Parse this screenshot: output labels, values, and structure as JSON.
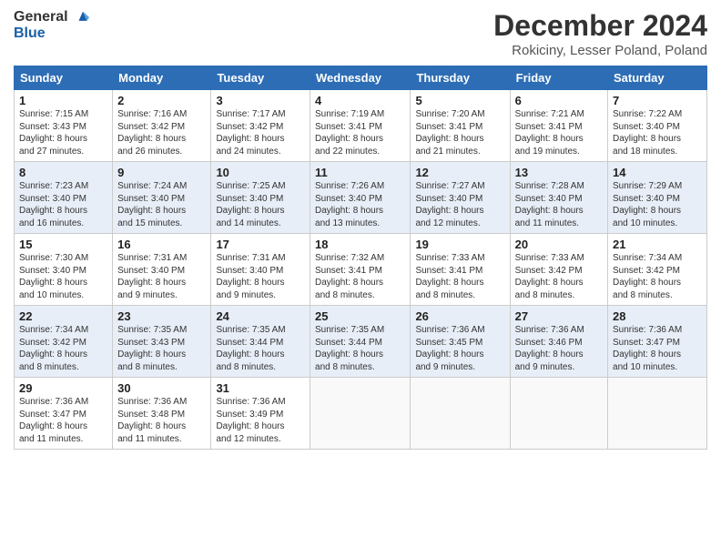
{
  "header": {
    "logo_line1": "General",
    "logo_line2": "Blue",
    "title": "December 2024",
    "subtitle": "Rokiciny, Lesser Poland, Poland"
  },
  "weekdays": [
    "Sunday",
    "Monday",
    "Tuesday",
    "Wednesday",
    "Thursday",
    "Friday",
    "Saturday"
  ],
  "weeks": [
    [
      {
        "day": "1",
        "info": "Sunrise: 7:15 AM\nSunset: 3:43 PM\nDaylight: 8 hours\nand 27 minutes."
      },
      {
        "day": "2",
        "info": "Sunrise: 7:16 AM\nSunset: 3:42 PM\nDaylight: 8 hours\nand 26 minutes."
      },
      {
        "day": "3",
        "info": "Sunrise: 7:17 AM\nSunset: 3:42 PM\nDaylight: 8 hours\nand 24 minutes."
      },
      {
        "day": "4",
        "info": "Sunrise: 7:19 AM\nSunset: 3:41 PM\nDaylight: 8 hours\nand 22 minutes."
      },
      {
        "day": "5",
        "info": "Sunrise: 7:20 AM\nSunset: 3:41 PM\nDaylight: 8 hours\nand 21 minutes."
      },
      {
        "day": "6",
        "info": "Sunrise: 7:21 AM\nSunset: 3:41 PM\nDaylight: 8 hours\nand 19 minutes."
      },
      {
        "day": "7",
        "info": "Sunrise: 7:22 AM\nSunset: 3:40 PM\nDaylight: 8 hours\nand 18 minutes."
      }
    ],
    [
      {
        "day": "8",
        "info": "Sunrise: 7:23 AM\nSunset: 3:40 PM\nDaylight: 8 hours\nand 16 minutes."
      },
      {
        "day": "9",
        "info": "Sunrise: 7:24 AM\nSunset: 3:40 PM\nDaylight: 8 hours\nand 15 minutes."
      },
      {
        "day": "10",
        "info": "Sunrise: 7:25 AM\nSunset: 3:40 PM\nDaylight: 8 hours\nand 14 minutes."
      },
      {
        "day": "11",
        "info": "Sunrise: 7:26 AM\nSunset: 3:40 PM\nDaylight: 8 hours\nand 13 minutes."
      },
      {
        "day": "12",
        "info": "Sunrise: 7:27 AM\nSunset: 3:40 PM\nDaylight: 8 hours\nand 12 minutes."
      },
      {
        "day": "13",
        "info": "Sunrise: 7:28 AM\nSunset: 3:40 PM\nDaylight: 8 hours\nand 11 minutes."
      },
      {
        "day": "14",
        "info": "Sunrise: 7:29 AM\nSunset: 3:40 PM\nDaylight: 8 hours\nand 10 minutes."
      }
    ],
    [
      {
        "day": "15",
        "info": "Sunrise: 7:30 AM\nSunset: 3:40 PM\nDaylight: 8 hours\nand 10 minutes."
      },
      {
        "day": "16",
        "info": "Sunrise: 7:31 AM\nSunset: 3:40 PM\nDaylight: 8 hours\nand 9 minutes."
      },
      {
        "day": "17",
        "info": "Sunrise: 7:31 AM\nSunset: 3:40 PM\nDaylight: 8 hours\nand 9 minutes."
      },
      {
        "day": "18",
        "info": "Sunrise: 7:32 AM\nSunset: 3:41 PM\nDaylight: 8 hours\nand 8 minutes."
      },
      {
        "day": "19",
        "info": "Sunrise: 7:33 AM\nSunset: 3:41 PM\nDaylight: 8 hours\nand 8 minutes."
      },
      {
        "day": "20",
        "info": "Sunrise: 7:33 AM\nSunset: 3:42 PM\nDaylight: 8 hours\nand 8 minutes."
      },
      {
        "day": "21",
        "info": "Sunrise: 7:34 AM\nSunset: 3:42 PM\nDaylight: 8 hours\nand 8 minutes."
      }
    ],
    [
      {
        "day": "22",
        "info": "Sunrise: 7:34 AM\nSunset: 3:42 PM\nDaylight: 8 hours\nand 8 minutes."
      },
      {
        "day": "23",
        "info": "Sunrise: 7:35 AM\nSunset: 3:43 PM\nDaylight: 8 hours\nand 8 minutes."
      },
      {
        "day": "24",
        "info": "Sunrise: 7:35 AM\nSunset: 3:44 PM\nDaylight: 8 hours\nand 8 minutes."
      },
      {
        "day": "25",
        "info": "Sunrise: 7:35 AM\nSunset: 3:44 PM\nDaylight: 8 hours\nand 8 minutes."
      },
      {
        "day": "26",
        "info": "Sunrise: 7:36 AM\nSunset: 3:45 PM\nDaylight: 8 hours\nand 9 minutes."
      },
      {
        "day": "27",
        "info": "Sunrise: 7:36 AM\nSunset: 3:46 PM\nDaylight: 8 hours\nand 9 minutes."
      },
      {
        "day": "28",
        "info": "Sunrise: 7:36 AM\nSunset: 3:47 PM\nDaylight: 8 hours\nand 10 minutes."
      }
    ],
    [
      {
        "day": "29",
        "info": "Sunrise: 7:36 AM\nSunset: 3:47 PM\nDaylight: 8 hours\nand 11 minutes."
      },
      {
        "day": "30",
        "info": "Sunrise: 7:36 AM\nSunset: 3:48 PM\nDaylight: 8 hours\nand 11 minutes."
      },
      {
        "day": "31",
        "info": "Sunrise: 7:36 AM\nSunset: 3:49 PM\nDaylight: 8 hours\nand 12 minutes."
      },
      null,
      null,
      null,
      null
    ]
  ]
}
